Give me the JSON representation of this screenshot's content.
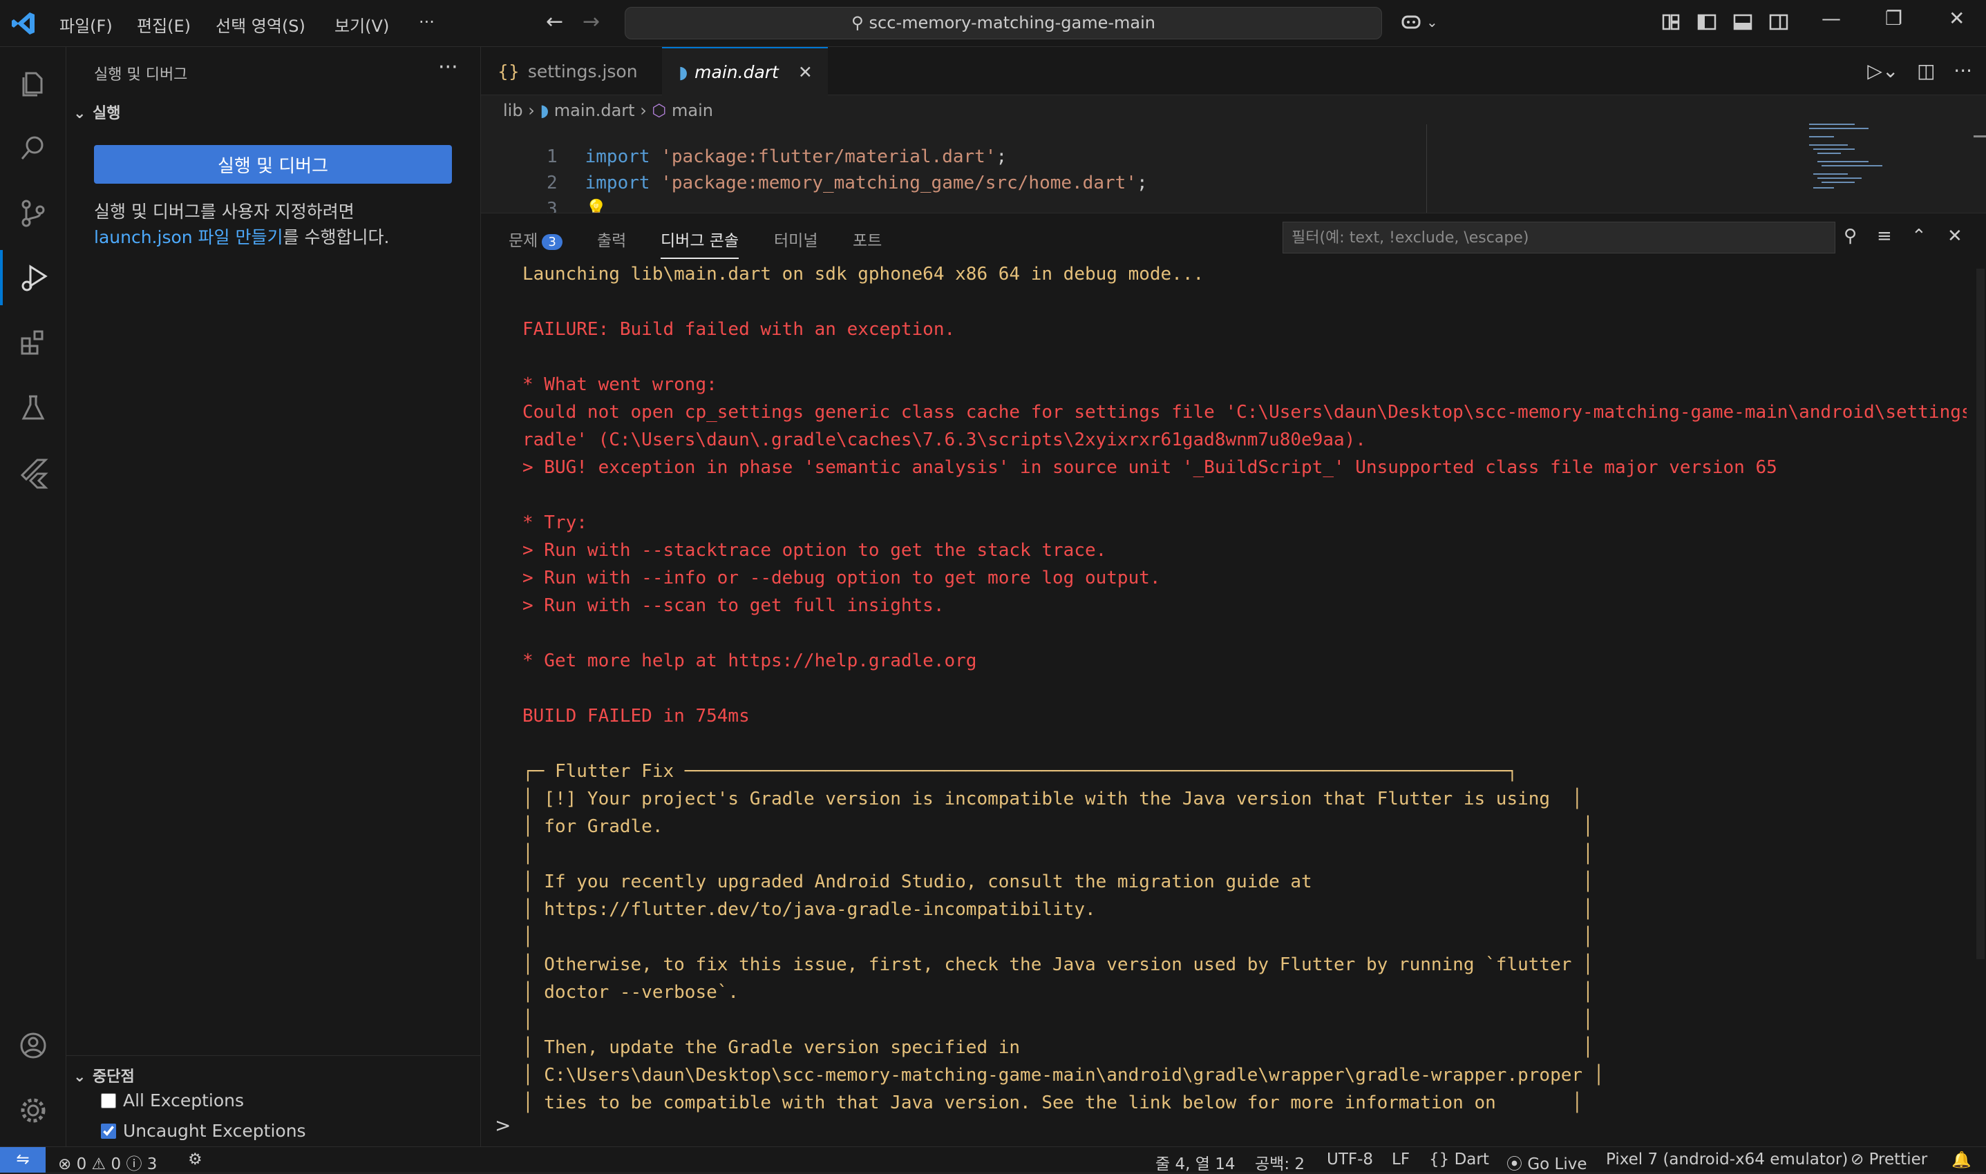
{
  "colors": {
    "accent": "#0078d4",
    "error": "#f14c4c",
    "warning_text": "#e5c07b",
    "button": "#3c78d8"
  },
  "titlebar": {
    "menus": [
      "파일(F)",
      "편집(E)",
      "선택 영역(S)",
      "보기(V)",
      "···"
    ],
    "search": "scc-memory-matching-game-main"
  },
  "sidebar": {
    "title": "실행 및 디버그",
    "more": "···",
    "run_section": "실행",
    "run_button": "실행 및 디버그",
    "desc_line1": "실행 및 디버그를 사용자 지정하려면",
    "desc_link": "launch.json 파일 만들기",
    "desc_tail": "를 수행합니다.",
    "breakpoints_section": "중단점",
    "breakpoints": [
      {
        "label": "All Exceptions",
        "checked": false
      },
      {
        "label": "Uncaught Exceptions",
        "checked": true
      }
    ]
  },
  "editor": {
    "tabs": [
      {
        "label": "settings.json",
        "icon": "{}"
      },
      {
        "label": "main.dart",
        "active": true
      }
    ],
    "breadcrumb": [
      "lib",
      "main.dart",
      "main"
    ],
    "lines": [
      {
        "num": "1",
        "kw": "import",
        "str": "'package:flutter/material.dart'",
        "end": ";"
      },
      {
        "num": "2",
        "kw": "import",
        "str": "'package:memory_matching_game/src/home.dart'",
        "end": ";"
      },
      {
        "num": "3",
        "kw": "",
        "str": "",
        "end": ""
      }
    ]
  },
  "panel": {
    "tabs": [
      "문제",
      "출력",
      "디버그 콘솔",
      "터미널",
      "포트"
    ],
    "problems_count": "3",
    "filter_placeholder": "필터(예: text, !exclude, \\escape)",
    "prompt": ">",
    "console": [
      {
        "t": "Launching lib\\main.dart on sdk gphone64 x86 64 in debug mode...",
        "c": "y"
      },
      {
        "t": "",
        "c": "y"
      },
      {
        "t": "FAILURE: Build failed with an exception.",
        "c": "r"
      },
      {
        "t": "",
        "c": "r"
      },
      {
        "t": "* What went wrong:",
        "c": "r"
      },
      {
        "t": "Could not open cp_settings generic class cache for settings file 'C:\\Users\\daun\\Desktop\\scc-memory-matching-game-main\\android\\settings.g",
        "c": "r"
      },
      {
        "t": "radle' (C:\\Users\\daun\\.gradle\\caches\\7.6.3\\scripts\\2xyixrxr61gad8wnm7u80e9aa).",
        "c": "r"
      },
      {
        "t": "> BUG! exception in phase 'semantic analysis' in source unit '_BuildScript_' Unsupported class file major version 65",
        "c": "r"
      },
      {
        "t": "",
        "c": "r"
      },
      {
        "t": "* Try:",
        "c": "r"
      },
      {
        "t": "> Run with --stacktrace option to get the stack trace.",
        "c": "r"
      },
      {
        "t": "> Run with --info or --debug option to get more log output.",
        "c": "r"
      },
      {
        "t": "> Run with --scan to get full insights.",
        "c": "r"
      },
      {
        "t": "",
        "c": "r"
      },
      {
        "t": "* Get more help at https://help.gradle.org",
        "c": "r"
      },
      {
        "t": "",
        "c": "r"
      },
      {
        "t": "BUILD FAILED in 754ms",
        "c": "r"
      },
      {
        "t": "",
        "c": "r"
      },
      {
        "t": "┌─ Flutter Fix ────────────────────────────────────────────────────────────────────────────┐",
        "c": "y"
      },
      {
        "t": "│ [!] Your project's Gradle version is incompatible with the Java version that Flutter is using  │",
        "c": "y"
      },
      {
        "t": "│ for Gradle.                                                                                     │",
        "c": "y"
      },
      {
        "t": "│                                                                                                 │",
        "c": "y"
      },
      {
        "t": "│ If you recently upgraded Android Studio, consult the migration guide at                         │",
        "c": "y"
      },
      {
        "t": "│ https://flutter.dev/to/java-gradle-incompatibility.                                             │",
        "c": "y"
      },
      {
        "t": "│                                                                                                 │",
        "c": "y"
      },
      {
        "t": "│ Otherwise, to fix this issue, first, check the Java version used by Flutter by running `flutter │",
        "c": "y"
      },
      {
        "t": "│ doctor --verbose`.                                                                              │",
        "c": "y"
      },
      {
        "t": "│                                                                                                 │",
        "c": "y"
      },
      {
        "t": "│ Then, update the Gradle version specified in                                                    │",
        "c": "y"
      },
      {
        "t": "│ C:\\Users\\daun\\Desktop\\scc-memory-matching-game-main\\android\\gradle\\wrapper\\gradle-wrapper.proper │",
        "c": "y"
      },
      {
        "t": "│ ties to be compatible with that Java version. See the link below for more information on       │",
        "c": "y"
      }
    ]
  },
  "status": {
    "errors": "0",
    "warnings": "0",
    "infos": "3",
    "position": "줄 4, 열 14",
    "spaces": "공백: 2",
    "encoding": "UTF-8",
    "eol": "LF",
    "language": "Dart",
    "golive": "Go Live",
    "device": "Pixel 7 (android-x64 emulator)",
    "prettier": "Prettier"
  }
}
